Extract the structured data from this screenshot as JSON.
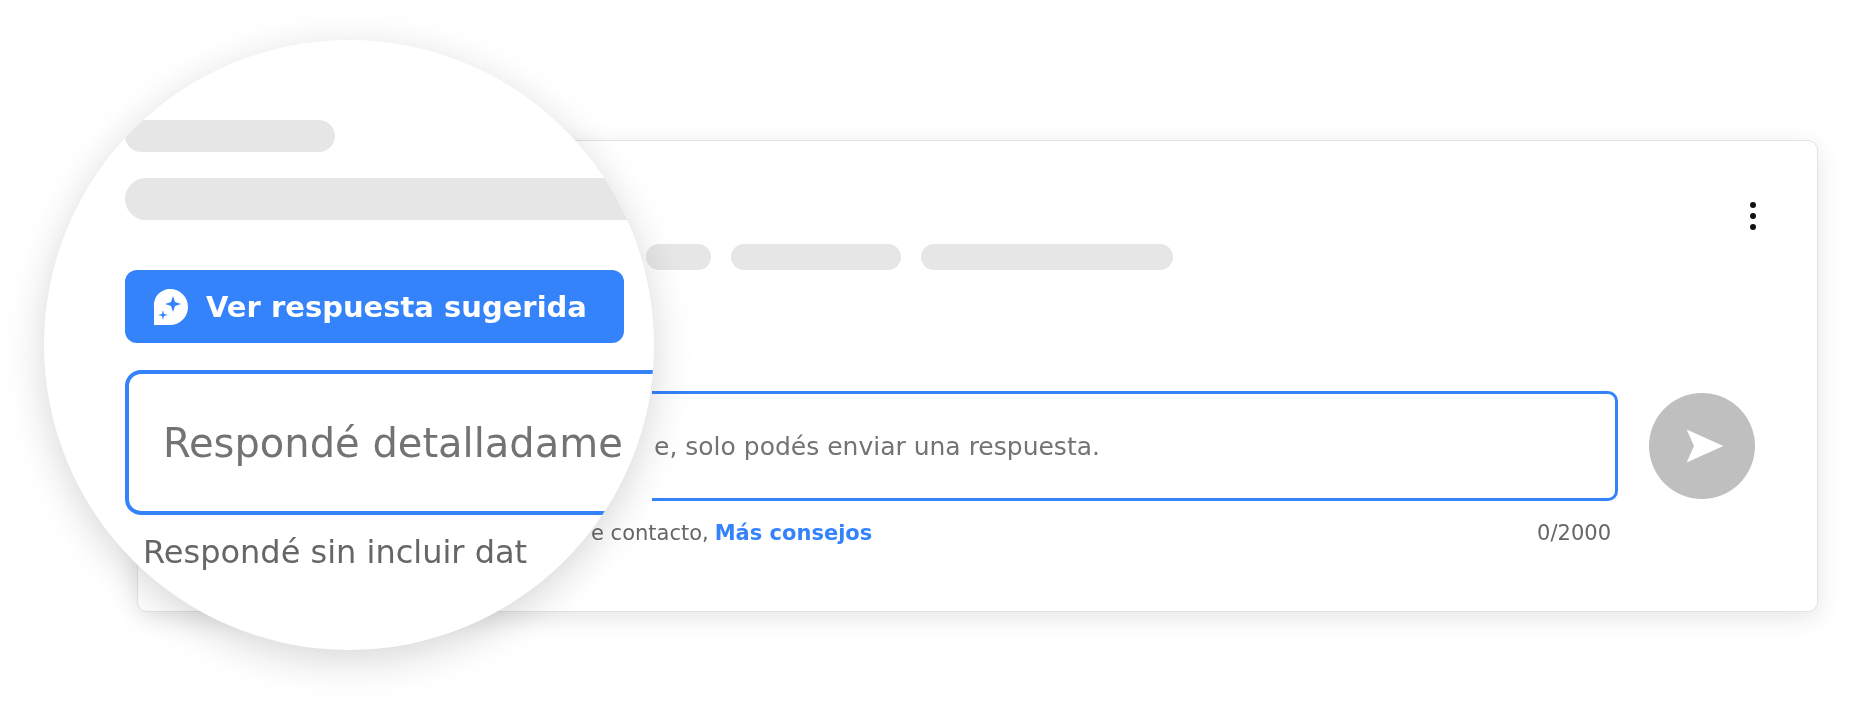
{
  "question_card": {
    "answer_field": {
      "placeholder": "e, solo podés enviar una respuesta.",
      "focused": true
    },
    "helper_text": "e contacto,",
    "help_link": "Más consejos",
    "char_count": "0/2000",
    "send_button": {
      "disabled": true
    }
  },
  "magnifier": {
    "suggest_button": "Ver respuesta sugerida",
    "answer_field": {
      "placeholder": "Respondé detalladame",
      "focused": true
    },
    "helper_text": "Respondé sin incluir dat"
  }
}
